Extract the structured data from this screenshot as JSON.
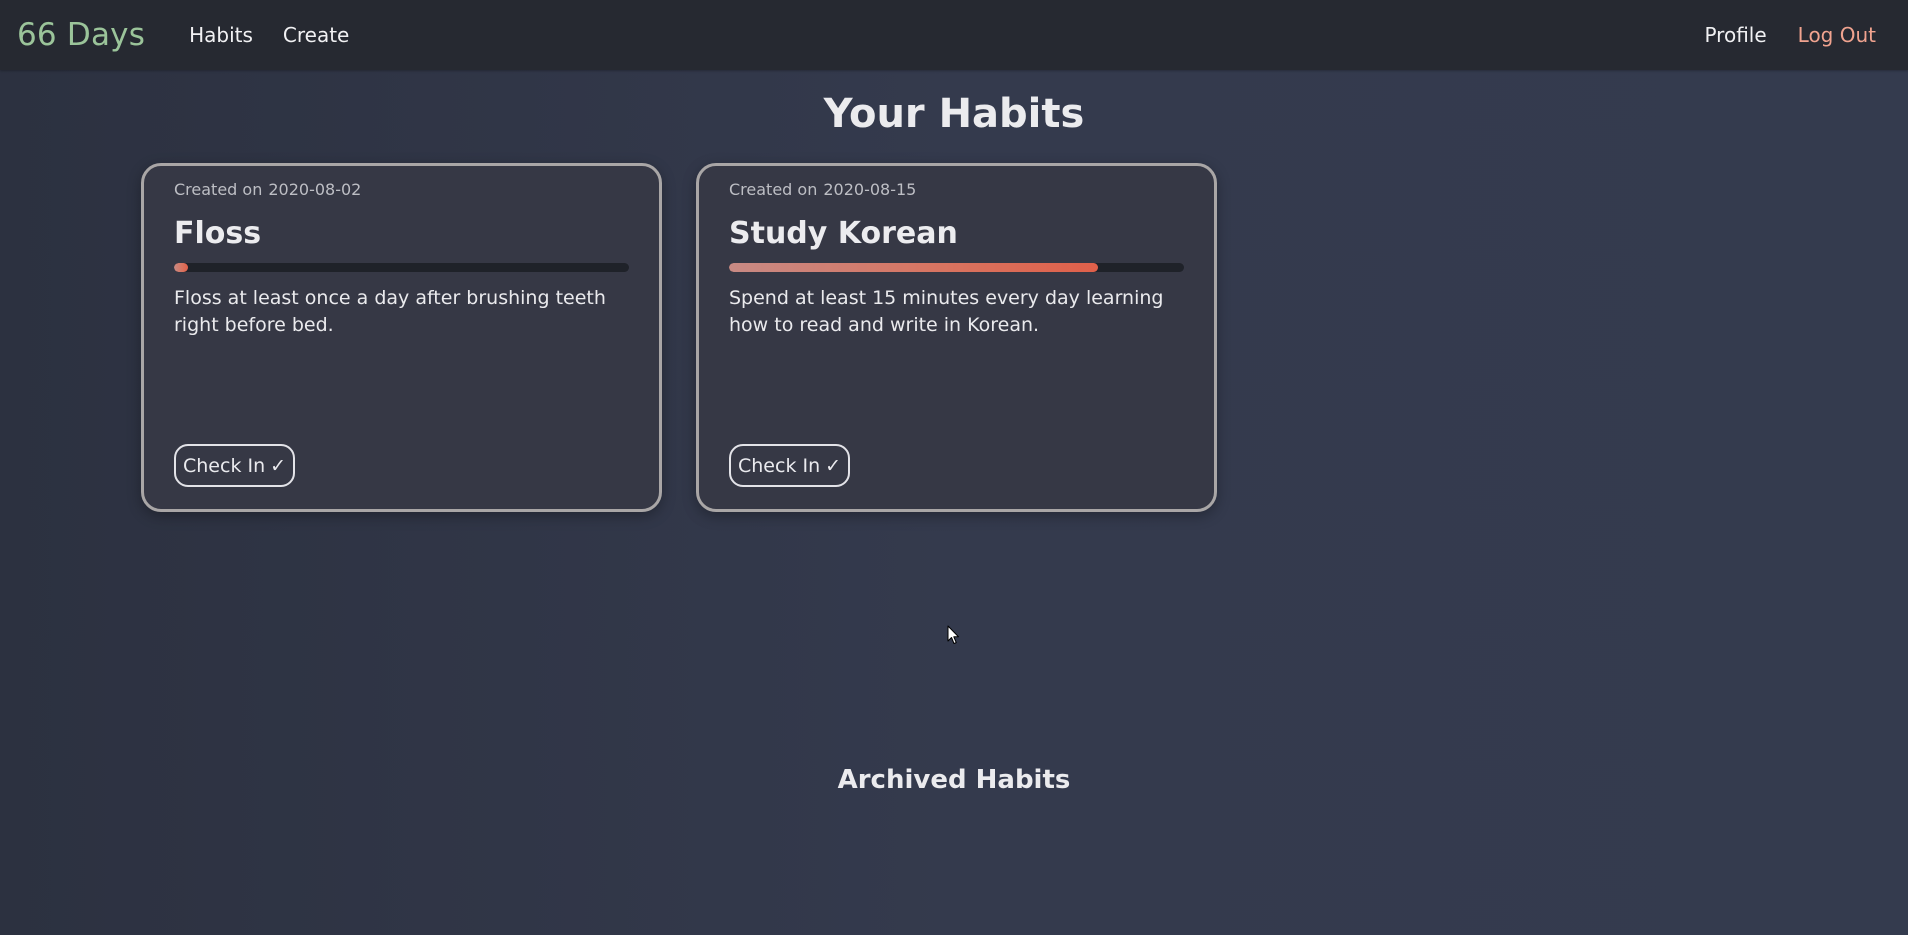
{
  "nav": {
    "brand": "66 Days",
    "links": [
      "Habits",
      "Create"
    ],
    "profile": "Profile",
    "logout": "Log Out"
  },
  "page": {
    "title": "Your Habits",
    "archived_title": "Archived Habits"
  },
  "habits": [
    {
      "created_prefix": "Created on",
      "created_date": "2020-08-02",
      "name": "Floss",
      "progress": 0.03,
      "description": "Floss at least once a day after brushing teeth right before bed.",
      "checkin_label": "Check In",
      "checkin_glyph": "✓"
    },
    {
      "created_prefix": "Created on",
      "created_date": "2020-08-15",
      "name": "Study Korean",
      "progress": 0.81,
      "description": "Spend at least 15 minutes every day learning how to read and write in Korean.",
      "checkin_label": "Check In",
      "checkin_glyph": "✓"
    }
  ],
  "colors": {
    "brand": "#9bc49a",
    "logout": "#f0a38f",
    "navbar": "#262931",
    "card_border": "#a9a6a6",
    "progress_start": "#c88a84",
    "progress_end": "#e0604a"
  },
  "icons": {
    "checkin": "check-mark-icon",
    "cursor": "mouse-pointer-icon"
  }
}
